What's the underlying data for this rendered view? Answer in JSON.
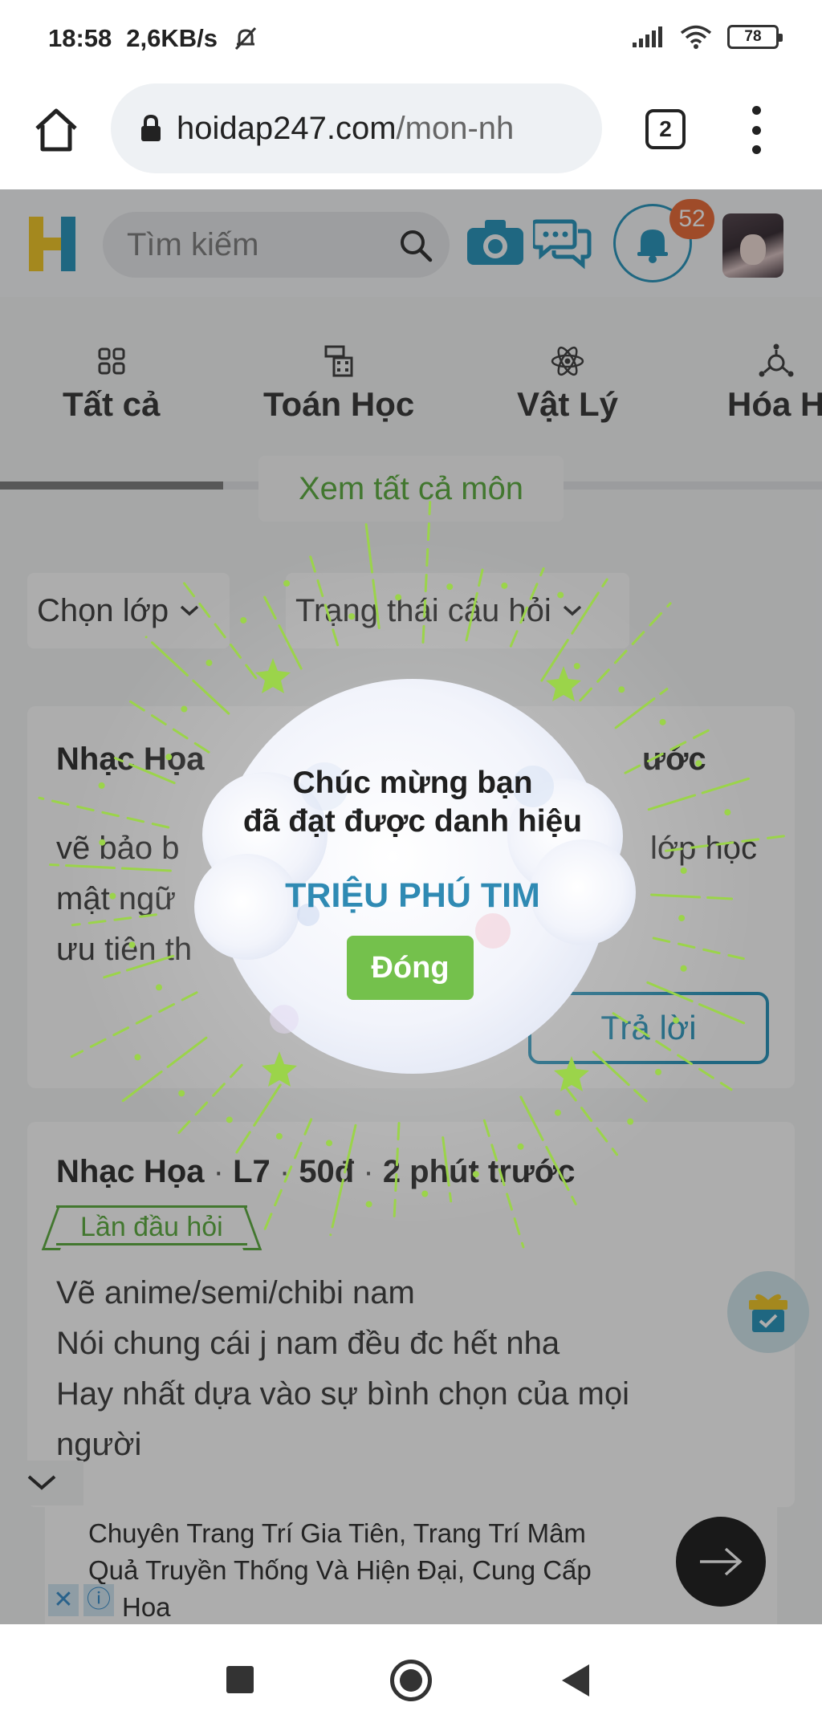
{
  "status_bar": {
    "time": "18:58",
    "speed": "2,6KB/s",
    "battery": "78"
  },
  "browser": {
    "url_host": "hoidap247.com",
    "url_path": "/mon-nh",
    "tab_count": "2"
  },
  "site_header": {
    "search_placeholder": "Tìm kiếm",
    "notification_count": "52"
  },
  "subjects": [
    {
      "label": "Tất cả",
      "icon": "grid-icon"
    },
    {
      "label": "Toán Học",
      "icon": "calculator-icon"
    },
    {
      "label": "Vật Lý",
      "icon": "atom-icon"
    },
    {
      "label": "Hóa H",
      "icon": "molecule-icon"
    }
  ],
  "view_all_label": "Xem tất cả môn",
  "filters": {
    "grade": "Chọn lớp",
    "status": "Trạng thái câu hỏi"
  },
  "questions": [
    {
      "subject": "Nhạc Họa",
      "meta_tail": "ước",
      "lines": [
        "vẽ bảo b",
        "mật ngữ",
        "ưu tiên th"
      ],
      "line_tail": "lớp học",
      "answer_label": "Trả lời"
    },
    {
      "subject": "Nhạc Họa",
      "grade": "L7",
      "points": "50đ",
      "time": "2 phút trước",
      "tag": "Lần đầu hỏi",
      "lines": [
        "Vẽ anime/semi/chibi nam",
        "Nói chung cái j nam đều đc hết nha",
        "Hay nhất dựa vào sự bình chọn của mọi",
        "người"
      ]
    }
  ],
  "ad": {
    "lines": [
      "Chuyên Trang Trí Gia Tiên, Trang Trí Mâm",
      "Quả Truyền Thống Và Hiện Đại, Cung Cấp",
      "Hoa"
    ],
    "close_x": "✕",
    "info": "ⓘ"
  },
  "popup": {
    "line1": "Chúc mừng bạn",
    "line2": "đã đạt được danh hiệu",
    "award": "TRIỆU PHÚ TIM",
    "close_label": "Đóng"
  },
  "colors": {
    "brand_green": "#74c14c",
    "brand_blue": "#1b8fb8",
    "badge_orange": "#e8622b"
  }
}
